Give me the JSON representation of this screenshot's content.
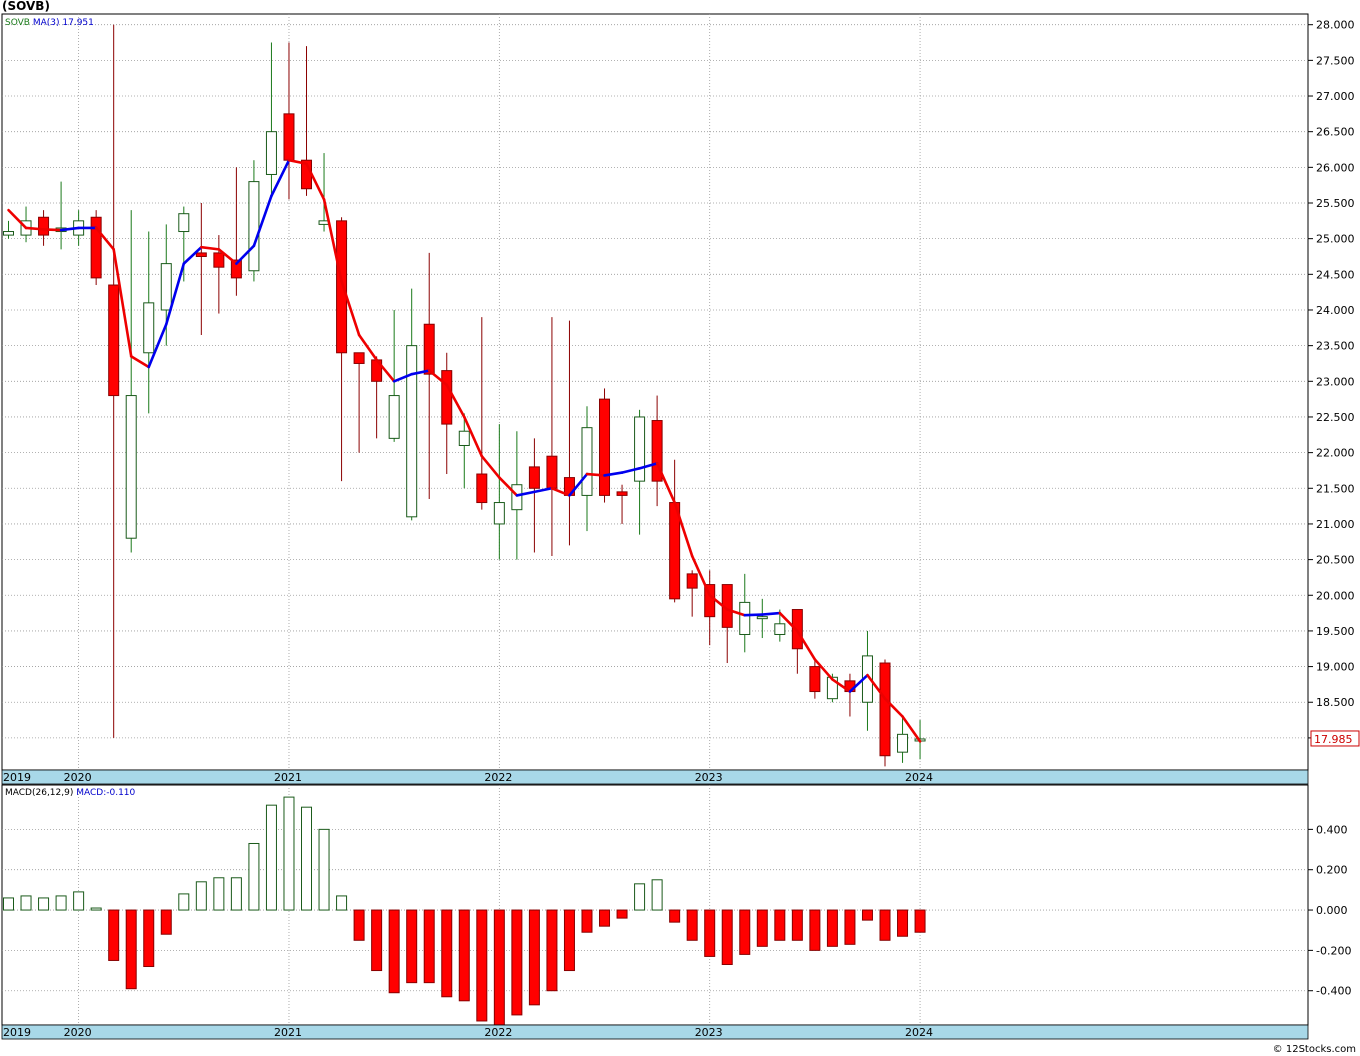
{
  "header": {
    "title": "(SOVB)"
  },
  "footer": {
    "credit": "© 12Stocks.com"
  },
  "chart_data": [
    {
      "type": "candlestick",
      "legend": {
        "symbol": "SOVB",
        "ma_label": "MA(3)",
        "ma_value": "17.951"
      },
      "last_price_label": "17.985",
      "ylim": [
        17.55,
        28.15
      ],
      "y_ticks": [
        "28.000",
        "27.500",
        "27.000",
        "26.500",
        "26.000",
        "25.500",
        "25.000",
        "24.500",
        "24.000",
        "23.500",
        "23.000",
        "22.500",
        "22.000",
        "21.500",
        "21.000",
        "20.500",
        "20.000",
        "19.500",
        "19.000",
        "18.500",
        "18.000"
      ],
      "x_axis_labels": [
        {
          "label": "2019",
          "index": -1
        },
        {
          "label": "2020",
          "index": 4
        },
        {
          "label": "2021",
          "index": 16
        },
        {
          "label": "2022",
          "index": 28
        },
        {
          "label": "2023",
          "index": 40
        },
        {
          "label": "2024",
          "index": 52
        }
      ],
      "candles": [
        {
          "o": 25.05,
          "h": 25.25,
          "l": 25.0,
          "c": 25.1
        },
        {
          "o": 25.05,
          "h": 25.45,
          "l": 24.95,
          "c": 25.25
        },
        {
          "o": 25.3,
          "h": 25.4,
          "l": 24.9,
          "c": 25.05
        },
        {
          "o": 25.1,
          "h": 25.8,
          "l": 24.85,
          "c": 25.15
        },
        {
          "o": 25.05,
          "h": 25.4,
          "l": 24.9,
          "c": 25.25
        },
        {
          "o": 25.3,
          "h": 25.4,
          "l": 24.35,
          "c": 24.45
        },
        {
          "o": 24.35,
          "h": 28.0,
          "l": 18.0,
          "c": 22.8
        },
        {
          "o": 20.8,
          "h": 25.4,
          "l": 20.6,
          "c": 22.8
        },
        {
          "o": 23.4,
          "h": 25.1,
          "l": 22.55,
          "c": 24.1
        },
        {
          "o": 24.0,
          "h": 25.2,
          "l": 23.5,
          "c": 24.65
        },
        {
          "o": 25.1,
          "h": 25.45,
          "l": 24.4,
          "c": 25.35
        },
        {
          "o": 24.8,
          "h": 25.5,
          "l": 23.65,
          "c": 24.75
        },
        {
          "o": 24.8,
          "h": 25.05,
          "l": 23.95,
          "c": 24.6
        },
        {
          "o": 24.7,
          "h": 26.0,
          "l": 24.2,
          "c": 24.45
        },
        {
          "o": 24.55,
          "h": 26.1,
          "l": 24.4,
          "c": 25.8
        },
        {
          "o": 25.9,
          "h": 27.75,
          "l": 25.6,
          "c": 26.5
        },
        {
          "o": 26.75,
          "h": 27.75,
          "l": 25.55,
          "c": 26.1
        },
        {
          "o": 26.1,
          "h": 27.7,
          "l": 25.6,
          "c": 25.7
        },
        {
          "o": 25.2,
          "h": 26.2,
          "l": 25.1,
          "c": 25.25
        },
        {
          "o": 25.25,
          "h": 25.3,
          "l": 21.6,
          "c": 23.4
        },
        {
          "o": 23.4,
          "h": 23.4,
          "l": 22.0,
          "c": 23.25
        },
        {
          "o": 23.3,
          "h": 23.35,
          "l": 22.2,
          "c": 23.0
        },
        {
          "o": 22.2,
          "h": 24.0,
          "l": 22.15,
          "c": 22.8
        },
        {
          "o": 21.1,
          "h": 24.3,
          "l": 21.05,
          "c": 23.5
        },
        {
          "o": 23.8,
          "h": 24.8,
          "l": 21.35,
          "c": 23.1
        },
        {
          "o": 23.15,
          "h": 23.4,
          "l": 21.7,
          "c": 22.4
        },
        {
          "o": 22.1,
          "h": 22.55,
          "l": 21.5,
          "c": 22.3
        },
        {
          "o": 21.7,
          "h": 23.9,
          "l": 21.2,
          "c": 21.3
        },
        {
          "o": 21.0,
          "h": 22.4,
          "l": 20.5,
          "c": 21.3
        },
        {
          "o": 21.2,
          "h": 22.3,
          "l": 20.5,
          "c": 21.55
        },
        {
          "o": 21.8,
          "h": 22.2,
          "l": 20.6,
          "c": 21.5
        },
        {
          "o": 21.95,
          "h": 23.9,
          "l": 20.55,
          "c": 21.5
        },
        {
          "o": 21.65,
          "h": 23.85,
          "l": 20.7,
          "c": 21.4
        },
        {
          "o": 21.4,
          "h": 22.65,
          "l": 20.9,
          "c": 22.35
        },
        {
          "o": 22.75,
          "h": 22.9,
          "l": 21.3,
          "c": 21.4
        },
        {
          "o": 21.45,
          "h": 21.55,
          "l": 21.0,
          "c": 21.4
        },
        {
          "o": 21.6,
          "h": 22.6,
          "l": 20.85,
          "c": 22.5
        },
        {
          "o": 22.45,
          "h": 22.8,
          "l": 21.25,
          "c": 21.6
        },
        {
          "o": 21.3,
          "h": 21.9,
          "l": 19.9,
          "c": 19.95
        },
        {
          "o": 20.3,
          "h": 20.35,
          "l": 19.7,
          "c": 20.1
        },
        {
          "o": 20.15,
          "h": 20.35,
          "l": 19.3,
          "c": 19.7
        },
        {
          "o": 20.15,
          "h": 20.15,
          "l": 19.05,
          "c": 19.55
        },
        {
          "o": 19.45,
          "h": 20.3,
          "l": 19.2,
          "c": 19.9
        },
        {
          "o": 19.7,
          "h": 19.95,
          "l": 19.4,
          "c": 19.7
        },
        {
          "o": 19.45,
          "h": 19.8,
          "l": 19.35,
          "c": 19.6
        },
        {
          "o": 19.8,
          "h": 19.8,
          "l": 18.9,
          "c": 19.25
        },
        {
          "o": 19.0,
          "h": 19.1,
          "l": 18.55,
          "c": 18.65
        },
        {
          "o": 18.55,
          "h": 18.9,
          "l": 18.5,
          "c": 18.85
        },
        {
          "o": 18.8,
          "h": 18.9,
          "l": 18.3,
          "c": 18.65
        },
        {
          "o": 18.5,
          "h": 19.5,
          "l": 18.1,
          "c": 19.15
        },
        {
          "o": 19.05,
          "h": 19.1,
          "l": 17.6,
          "c": 17.75
        },
        {
          "o": 17.8,
          "h": 18.3,
          "l": 17.65,
          "c": 18.05
        },
        {
          "o": 17.98,
          "h": 18.25,
          "l": 17.7,
          "c": 17.985
        }
      ],
      "ma": [
        25.4,
        25.15,
        25.13,
        25.12,
        25.15,
        25.15,
        24.85,
        23.35,
        23.2,
        23.8,
        24.65,
        24.88,
        24.85,
        24.65,
        24.9,
        25.6,
        26.1,
        26.05,
        25.55,
        24.4,
        23.65,
        23.3,
        23.0,
        23.1,
        23.15,
        22.95,
        22.5,
        21.95,
        21.65,
        21.4,
        21.45,
        21.5,
        21.4,
        21.7,
        21.68,
        21.72,
        21.78,
        21.85,
        21.3,
        20.55,
        20.0,
        19.8,
        19.72,
        19.73,
        19.75,
        19.5,
        19.1,
        18.82,
        18.65,
        18.88,
        18.55,
        18.3,
        17.951
      ]
    },
    {
      "type": "bar",
      "legend": {
        "name": "MACD(26,12,9)",
        "value_label": "MACD:-0.110"
      },
      "ylim": [
        -0.57,
        0.62
      ],
      "y_ticks": [
        "0.400",
        "0.200",
        "0.000",
        "-0.200",
        "-0.400"
      ],
      "values": [
        0.06,
        0.07,
        0.06,
        0.07,
        0.09,
        0.01,
        -0.25,
        -0.39,
        -0.28,
        -0.12,
        0.08,
        0.14,
        0.16,
        0.16,
        0.33,
        0.52,
        0.56,
        0.51,
        0.4,
        0.07,
        -0.15,
        -0.3,
        -0.41,
        -0.36,
        -0.36,
        -0.43,
        -0.45,
        -0.55,
        -0.57,
        -0.52,
        -0.47,
        -0.4,
        -0.3,
        -0.11,
        -0.08,
        -0.04,
        0.13,
        0.15,
        -0.06,
        -0.15,
        -0.23,
        -0.27,
        -0.22,
        -0.18,
        -0.15,
        -0.15,
        -0.2,
        -0.18,
        -0.17,
        -0.05,
        -0.15,
        -0.13,
        -0.11
      ]
    }
  ]
}
